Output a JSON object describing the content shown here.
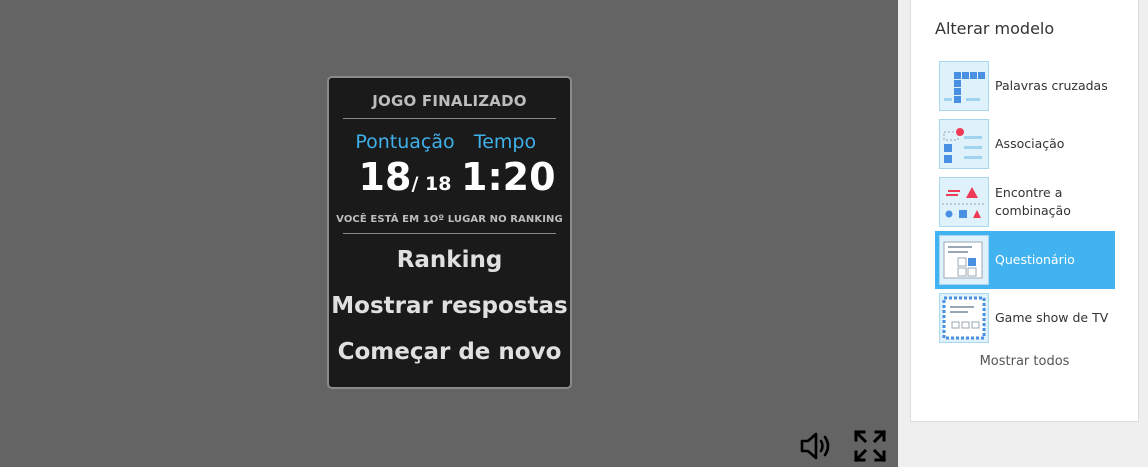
{
  "result": {
    "title": "JOGO FINALIZADO",
    "score_label": "Pontuação",
    "score_value": "18",
    "score_total": "/ 18",
    "time_label": "Tempo",
    "time_value": "1:20",
    "rank_note": "VOCÊ ESTÁ EM 1Oº LUGAR NO RANKING",
    "actions": [
      "Ranking",
      "Mostrar respostas",
      "Começar de novo"
    ]
  },
  "controls": {
    "sound_icon": "speaker-icon",
    "fullscreen_icon": "fullscreen-icon"
  },
  "panel": {
    "title": "Alterar modelo",
    "templates": [
      {
        "label": "Palavras cruzadas",
        "icon": "crossword-icon",
        "selected": false
      },
      {
        "label": "Associação",
        "icon": "match-up-icon",
        "selected": false
      },
      {
        "label": "Encontre a combinação",
        "icon": "find-the-match-icon",
        "selected": false
      },
      {
        "label": "Questionário",
        "icon": "quiz-icon",
        "selected": true
      },
      {
        "label": "Game show de TV",
        "icon": "gameshow-quiz-icon",
        "selected": false
      }
    ],
    "show_all": "Mostrar todos"
  },
  "colors": {
    "accent": "#40b3f0",
    "stat_label": "#3fb1ea",
    "stage": "#646464",
    "card": "#1a1a1a"
  }
}
